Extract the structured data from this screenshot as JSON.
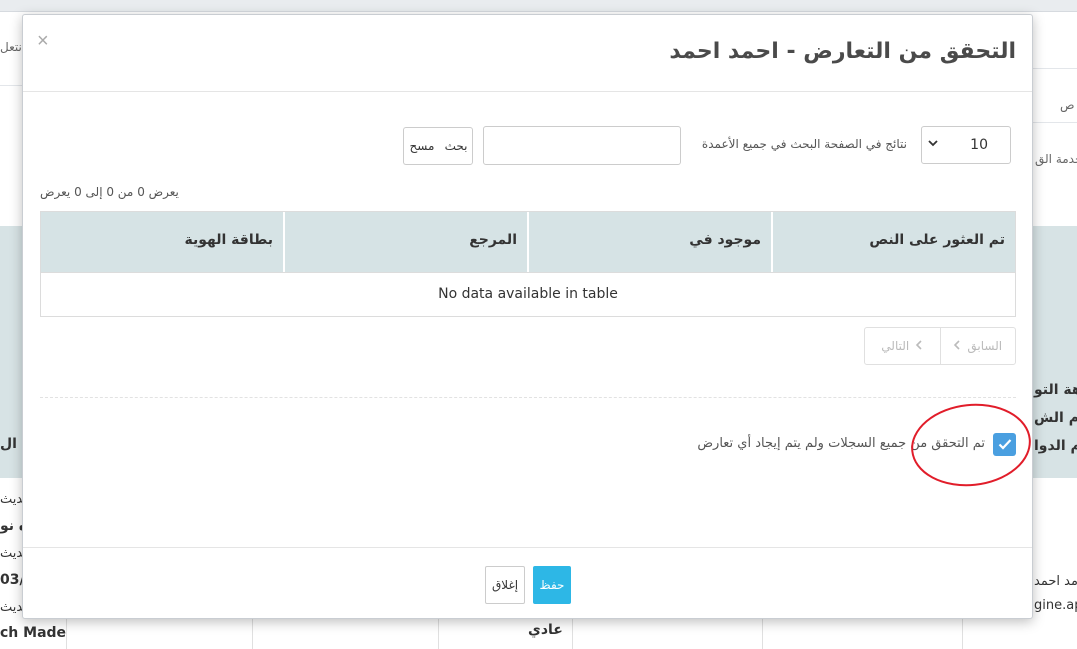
{
  "background": {
    "left_texts": [
      "بديث",
      "ه نو",
      "بديث",
      "03/",
      "بديث"
    ],
    "left_bold_row": "ch Made",
    "left_edge_label": "ل ال",
    "left_top_label": "نتعل",
    "right_top_label": "ص",
    "right_service_label": "خدمة الق",
    "right_side_labels": [
      "هة التو",
      "م الش",
      "م الدوا"
    ],
    "right_bottom_name": "مد احمد",
    "right_bottom_engine": "gine.ap",
    "bottom_cell_value": "عادي"
  },
  "modal": {
    "title": "التحقق من التعارض - احمد احمد",
    "close_symbol": "×",
    "length_select": {
      "value": "10",
      "label": "نتائج في الصفحة البحث في جميع الأعمدة"
    },
    "search": {
      "value": "",
      "placeholder": ""
    },
    "search_button": "بحث",
    "clear_button": "مسح",
    "info": "يعرض 0 من 0 إلى 0 يعرض",
    "table": {
      "columns": [
        "تم العثور على النص",
        "موجود في",
        "المرجع",
        "بطاقة الهوية"
      ],
      "empty_message": "No data available in table"
    },
    "pagination": {
      "previous": "السابق",
      "next": "التالي"
    },
    "confirm_checkbox": {
      "checked": true,
      "label": "تم التحقق من جميع السجلات ولم يتم إيجاد أي تعارض"
    },
    "footer": {
      "save": "حفظ",
      "close": "إغلاق"
    }
  },
  "colors": {
    "accent": "#2db7e6",
    "checkbox": "#4a9fe0",
    "table_header": "#d6e3e5",
    "annotation_ring": "#e11d2a"
  }
}
